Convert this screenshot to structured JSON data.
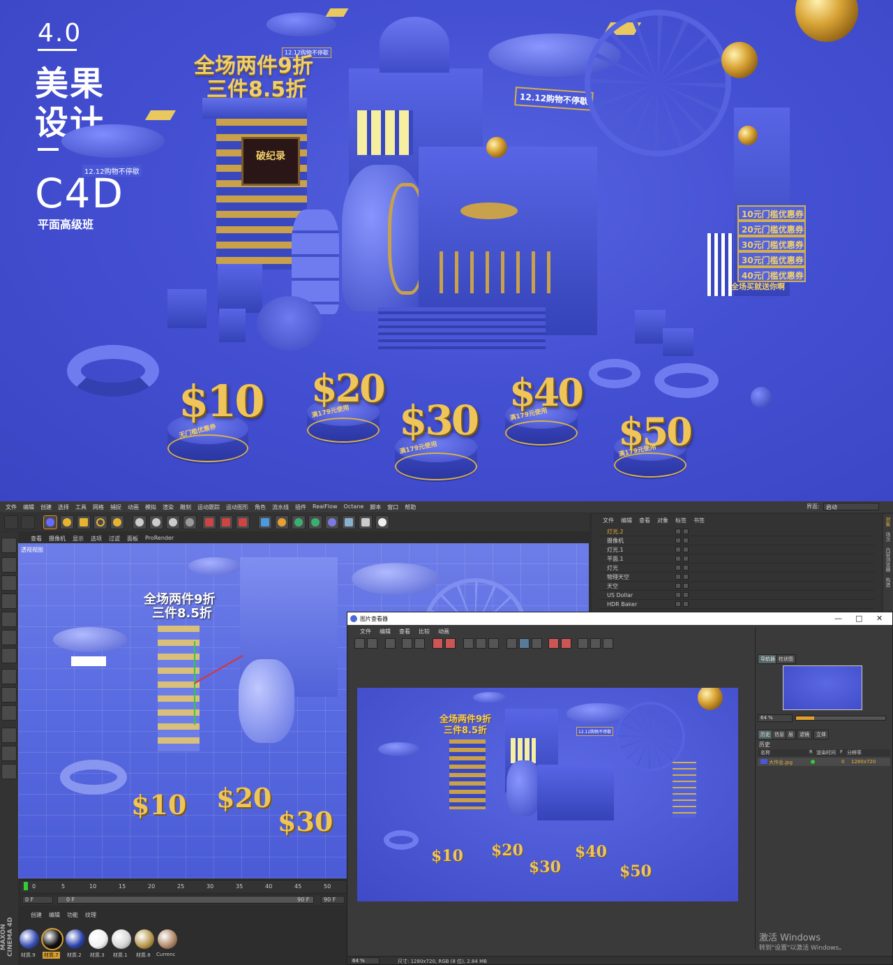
{
  "poster": {
    "brand": {
      "version": "4.0",
      "name_line1": "美果",
      "name_line2": "设计",
      "software": "C4D",
      "course": "平面高级班"
    },
    "headline": {
      "line1": "全场两件9折",
      "line2": "三件8.5折"
    },
    "banner_tag": "12.12购物不停歇",
    "blimp_tag_small": "12.12购物不停歇",
    "blimp_tag_left": "12.12购物不停歇",
    "screen_text": "破纪录",
    "coupons": [
      "10元门槛优惠券",
      "20元门槛优惠券",
      "30元门槛优惠券",
      "30元门槛优惠券",
      "40元门槛优惠券"
    ],
    "coupon_footer": "全场买就送你啊",
    "pedestals": [
      {
        "amount": "$10",
        "caption": "无门槛优惠券"
      },
      {
        "amount": "$20",
        "caption": "满179元使用"
      },
      {
        "amount": "$30",
        "caption": "满179元使用"
      },
      {
        "amount": "$40",
        "caption": "满179元使用"
      },
      {
        "amount": "$50",
        "caption": "满179元使用"
      }
    ]
  },
  "c4d": {
    "menu": [
      "文件",
      "编辑",
      "创建",
      "选择",
      "工具",
      "网格",
      "捕捉",
      "动画",
      "模拟",
      "渲染",
      "雕刻",
      "运动跟踪",
      "运动图形",
      "角色",
      "流水线",
      "插件",
      "RealFlow",
      "Octane",
      "脚本",
      "窗口",
      "帮助"
    ],
    "layout_label": "界面:",
    "layout_value": "启动",
    "viewport_menu": [
      "查看",
      "摄像机",
      "显示",
      "选项",
      "过滤",
      "面板",
      "ProRender"
    ],
    "viewport_label": "透视视图",
    "scene_text": {
      "line1": "全场两件9折",
      "line2": "三件8.5折"
    },
    "scene_numbers": [
      "$10",
      "$20",
      "$30"
    ],
    "object_menu": [
      "文件",
      "编辑",
      "查看",
      "对象",
      "标签",
      "书签"
    ],
    "objects": [
      "灯光.2",
      "摄像机",
      "灯光.1",
      "平面.1",
      "灯光",
      "物理天空",
      "天空",
      "US Dollar",
      "HDR Baker"
    ],
    "right_tabs": [
      "对象",
      "场次",
      "内容浏览器",
      "构造"
    ],
    "timeline": {
      "ticks": [
        "0",
        "5",
        "10",
        "15",
        "20",
        "25",
        "30",
        "35",
        "40",
        "45",
        "50"
      ],
      "start": "0 F",
      "field": "0 F",
      "end": "90 F",
      "end2": "90 F"
    },
    "material_menu": [
      "创建",
      "编辑",
      "功能",
      "纹理"
    ],
    "materials": [
      {
        "label": "材质.9",
        "color": "#3b52b8"
      },
      {
        "label": "材质.7",
        "color": "#111111"
      },
      {
        "label": "材质.2",
        "color": "#2e45b0"
      },
      {
        "label": "材质.3",
        "color": "#f2f2f2"
      },
      {
        "label": "材质.1",
        "color": "#d8d8d8"
      },
      {
        "label": "材质.8",
        "color": "#b89a50"
      },
      {
        "label": "Currenc",
        "color": "#b38c6e"
      }
    ],
    "brand_side": "MAXON CINEMA 4D"
  },
  "viewer": {
    "title": "图片查看器",
    "menu": [
      "文件",
      "编辑",
      "查看",
      "比较",
      "动画"
    ],
    "nav_tabs": [
      "导航器",
      "柱状图"
    ],
    "zoom": "64 %",
    "history_tabs": [
      "历史",
      "信息",
      "层",
      "滤镜",
      "立体"
    ],
    "history_label": "历史",
    "history_cols": [
      "名称",
      "R",
      "渲染时间",
      "F",
      "分辨率"
    ],
    "history_row": {
      "name": "大作业.jpg",
      "time": "0",
      "res": "1280x720"
    },
    "status_zoom": "64 %",
    "status_text": "尺寸: 1280x720, RGB (8 位), 2.84 MB",
    "render_headline": {
      "line1": "全场两件9折",
      "line2": "三件8.5折"
    },
    "render_numbers": [
      "$10",
      "$20",
      "$30",
      "$40",
      "$50"
    ],
    "render_tag": "12.12购物不停歇"
  },
  "windows_watermark": {
    "line1": "激活 Windows",
    "line2": "转到\"设置\"以激活 Windows。"
  },
  "colors": {
    "poster_bg": "#4450d2",
    "gold": "#f1cf6a",
    "ui_bg": "#2d2d2d",
    "selected": "#d9a030"
  }
}
